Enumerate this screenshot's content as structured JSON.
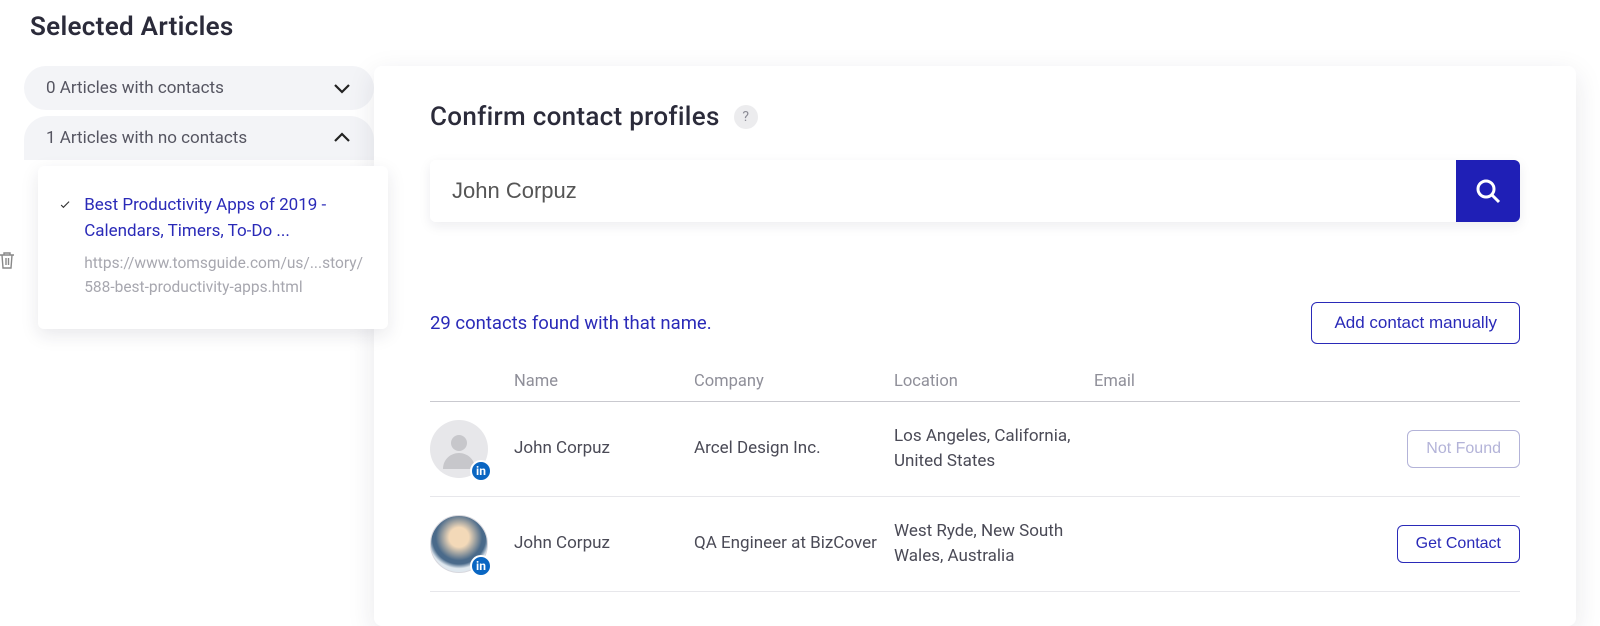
{
  "page_title": "Selected Articles",
  "sidebar": {
    "sections": [
      {
        "label": "0 Articles with contacts",
        "expanded": false
      },
      {
        "label": "1 Articles with no contacts",
        "expanded": true
      }
    ],
    "article": {
      "title": "Best Productivity Apps of 2019 - Calendars, Timers, To-Do ...",
      "url": "https://www.tomsguide.com/us/...story/588-best-productivity-apps.html"
    },
    "trash_icon": "trash-icon",
    "check_icon": "check-icon"
  },
  "main": {
    "title": "Confirm contact profiles",
    "help_glyph": "?",
    "search_value": "John Corpuz",
    "results_text": "29 contacts found with that name.",
    "add_manual_label": "Add contact manually",
    "columns": {
      "name": "Name",
      "company": "Company",
      "location": "Location",
      "email": "Email"
    },
    "rows": [
      {
        "name": "John Corpuz",
        "company": "Arcel Design Inc.",
        "location": "Los Angeles, California, United States",
        "email": "",
        "action_label": "Not Found",
        "action_muted": true,
        "avatar_type": "placeholder",
        "has_linkedin": true
      },
      {
        "name": "John Corpuz",
        "company": "QA Engineer at BizCover",
        "location": "West Ryde, New South Wales, Australia",
        "email": "",
        "action_label": "Get Contact",
        "action_muted": false,
        "avatar_type": "photo",
        "has_linkedin": true
      }
    ],
    "linkedin_glyph": "in"
  }
}
